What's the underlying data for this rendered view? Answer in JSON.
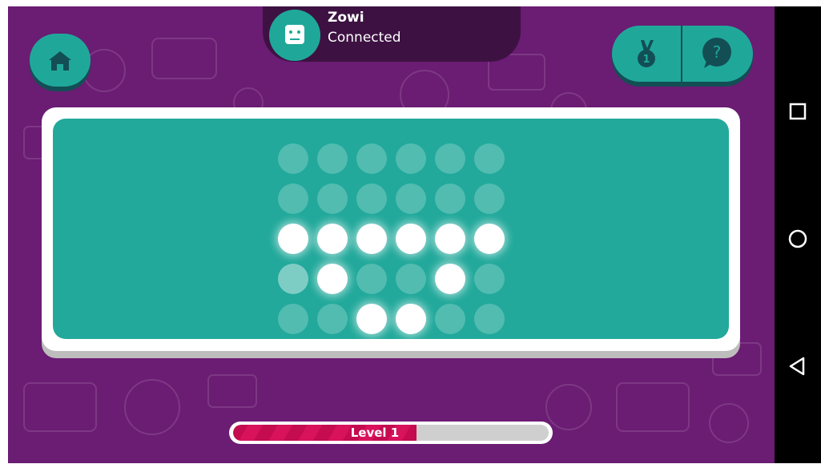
{
  "device": {
    "name": "Zowi",
    "status": "Connected",
    "icon": "robot-face-icon"
  },
  "buttons": {
    "home": {
      "icon": "home-icon"
    },
    "medal": {
      "icon": "medal-icon",
      "badge": "1"
    },
    "help": {
      "icon": "help-bubble-icon"
    }
  },
  "matrix": {
    "rows": 5,
    "cols": 6,
    "cells": [
      [
        0,
        0,
        0,
        0,
        0,
        0
      ],
      [
        0,
        0,
        0,
        0,
        0,
        0
      ],
      [
        1,
        1,
        1,
        1,
        1,
        1
      ],
      [
        2,
        1,
        0,
        0,
        1,
        0
      ],
      [
        0,
        0,
        1,
        1,
        0,
        0
      ]
    ]
  },
  "level": {
    "label": "Level 1",
    "progress": 0.58
  },
  "navbar": {
    "icons": [
      "recent-apps-icon",
      "home-circle-icon",
      "back-icon"
    ]
  },
  "colors": {
    "background": "#6b1c73",
    "accent": "#1fa89a",
    "progress": "#c40c4f"
  }
}
